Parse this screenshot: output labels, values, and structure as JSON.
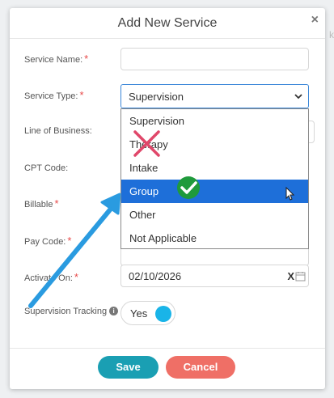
{
  "background": {
    "peek_text": "k"
  },
  "modal": {
    "title": "Add New Service",
    "close": "×"
  },
  "form": {
    "service_name": {
      "label": "Service Name:",
      "value": ""
    },
    "service_type": {
      "label": "Service Type:",
      "selected": "Supervision",
      "options": [
        "Supervision",
        "Therapy",
        "Intake",
        "Group",
        "Other",
        "Not Applicable"
      ],
      "highlighted": "Group"
    },
    "line_of_business": {
      "label": "Line of Business:"
    },
    "cpt_code": {
      "label": "CPT Code:"
    },
    "billable": {
      "label": "Billable"
    },
    "pay_code": {
      "label": "Pay Code:"
    },
    "activate_on": {
      "label": "Activate On:",
      "value": "02/10/2026",
      "clear": "X"
    },
    "supervision_tracking": {
      "label": "Supervision Tracking",
      "info": "i",
      "toggle_label": "Yes",
      "enabled": true
    }
  },
  "required_marker": "*",
  "buttons": {
    "save": "Save",
    "cancel": "Cancel"
  },
  "colors": {
    "accent_blue": "#1e6fd9",
    "save": "#1a9fb3",
    "cancel": "#ef6f66",
    "toggle_on": "#19b4e8",
    "annotation_arrow": "#2a9be0",
    "annotation_cross": "#e0476a",
    "annotation_check": "#1f9a3c"
  },
  "annotations": {
    "crossed_option": "Therapy",
    "checked_option": "Group",
    "arrow_target": "Service Type"
  }
}
